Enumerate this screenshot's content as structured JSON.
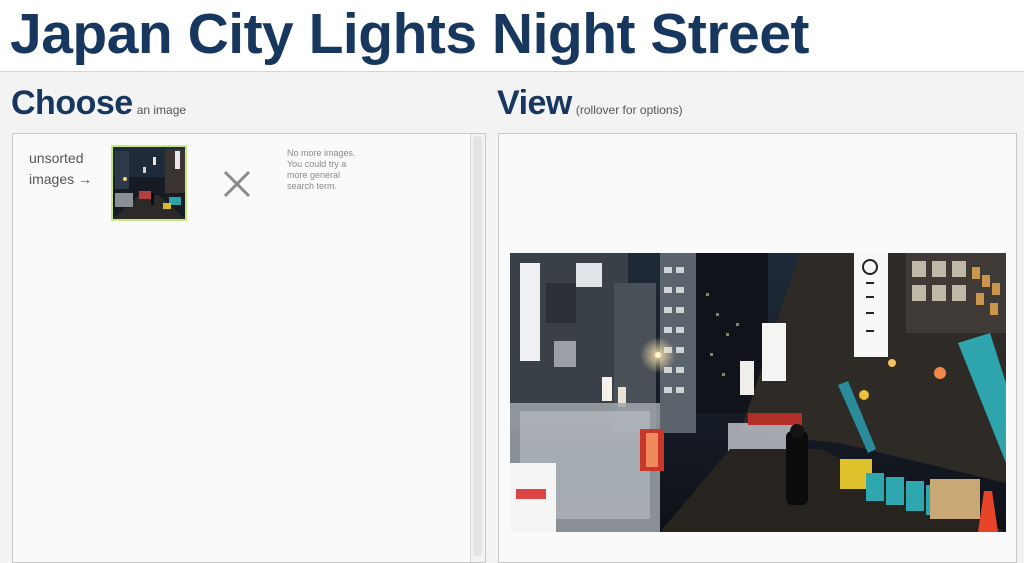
{
  "page": {
    "title": "Japan City Lights Night Street"
  },
  "choose": {
    "heading": "Choose",
    "subheading": "an image",
    "unsorted_label": "unsorted images →",
    "thumbnail_icon": "night-street-thumbnail",
    "remove_icon": "close-icon",
    "no_more_text": "No more images. You could try a more general search term."
  },
  "view": {
    "heading": "View",
    "subheading": "(rollover for options)",
    "image_icon": "night-street-photo"
  },
  "colors": {
    "title": "#17375e",
    "thumbnail_border": "#c5e884",
    "panel_background": "#fafafa",
    "page_background": "#f3f3f3"
  }
}
